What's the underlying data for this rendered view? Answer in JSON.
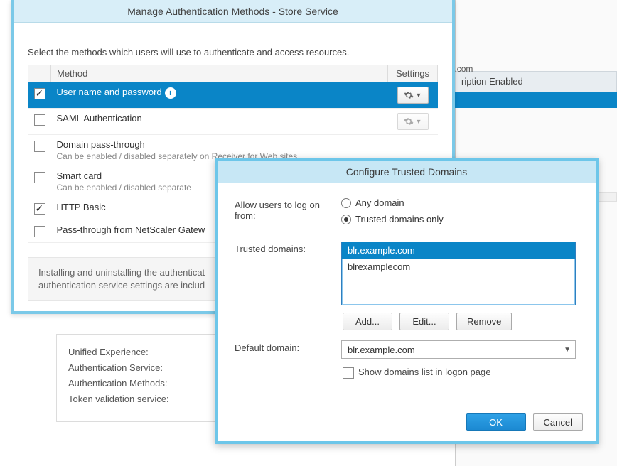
{
  "background": {
    "subscription_label": "ription Enabled",
    "tooltip_text": "blr.example.com"
  },
  "props": {
    "rows": [
      "Unified Experience:",
      "Authentication Service:",
      "Authentication Methods:",
      "",
      "Token validation service:"
    ]
  },
  "auth_dialog": {
    "title": "Manage Authentication Methods - Store Service",
    "instructions": "Select the methods which users will use to authenticate and access resources.",
    "columns": {
      "method": "Method",
      "settings": "Settings"
    },
    "rows": [
      {
        "label": "User name and password",
        "info": true,
        "checked": true,
        "selected": true,
        "gear": "enabled"
      },
      {
        "label": "SAML Authentication",
        "checked": false,
        "gear": "disabled"
      },
      {
        "label": "Domain pass-through",
        "sub": "Can be enabled / disabled separately on Receiver for Web sites",
        "checked": false
      },
      {
        "label": "Smart card",
        "sub": "Can be enabled / disabled separate",
        "checked": false
      },
      {
        "label": "HTTP Basic",
        "checked": true
      },
      {
        "label": "Pass-through from NetScaler Gatew",
        "checked": false
      }
    ],
    "footer": "Installing and uninstalling the authenticat\nauthentication service settings are includ"
  },
  "trusted_dialog": {
    "title": "Configure Trusted Domains",
    "allow_label": "Allow users to log on from:",
    "radio_any": "Any domain",
    "radio_trusted": "Trusted domains only",
    "radio_selected": "trusted",
    "trusted_label": "Trusted domains:",
    "domains": [
      {
        "text": "blr.example.com",
        "selected": true
      },
      {
        "text": "blrexamplecom",
        "selected": false
      }
    ],
    "btn_add": "Add...",
    "btn_edit": "Edit...",
    "btn_remove": "Remove",
    "default_label": "Default domain:",
    "default_value": "blr.example.com",
    "show_domains_label": "Show domains list in logon page",
    "show_domains_checked": false,
    "ok": "OK",
    "cancel": "Cancel"
  }
}
